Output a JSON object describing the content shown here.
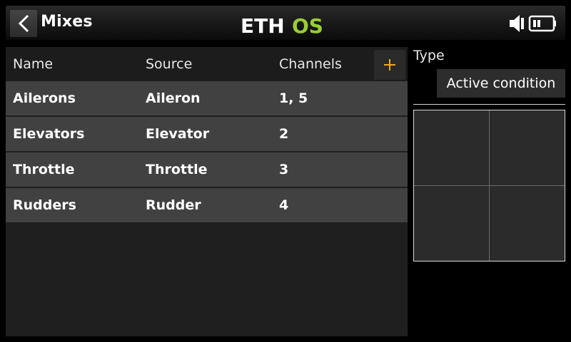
{
  "header": {
    "title": "Mixes",
    "logo": {
      "text_left": "ETH",
      "text_right": "OS",
      "accent_color": "#9ACD32"
    }
  },
  "icons": {
    "back": "chevron-left-icon",
    "add": "plus-icon",
    "speaker": "speaker-icon",
    "battery": "battery-icon"
  },
  "table": {
    "columns": [
      "Name",
      "Source",
      "Channels"
    ],
    "rows": [
      {
        "name": "Ailerons",
        "source": "Aileron",
        "channels": "1, 5"
      },
      {
        "name": "Elevators",
        "source": "Elevator",
        "channels": "2"
      },
      {
        "name": "Throttle",
        "source": "Throttle",
        "channels": "3"
      },
      {
        "name": "Rudders",
        "source": "Rudder",
        "channels": "4"
      }
    ],
    "add_color": "#f5a623"
  },
  "side": {
    "type_label": "Type",
    "type_value": "Active condition"
  }
}
